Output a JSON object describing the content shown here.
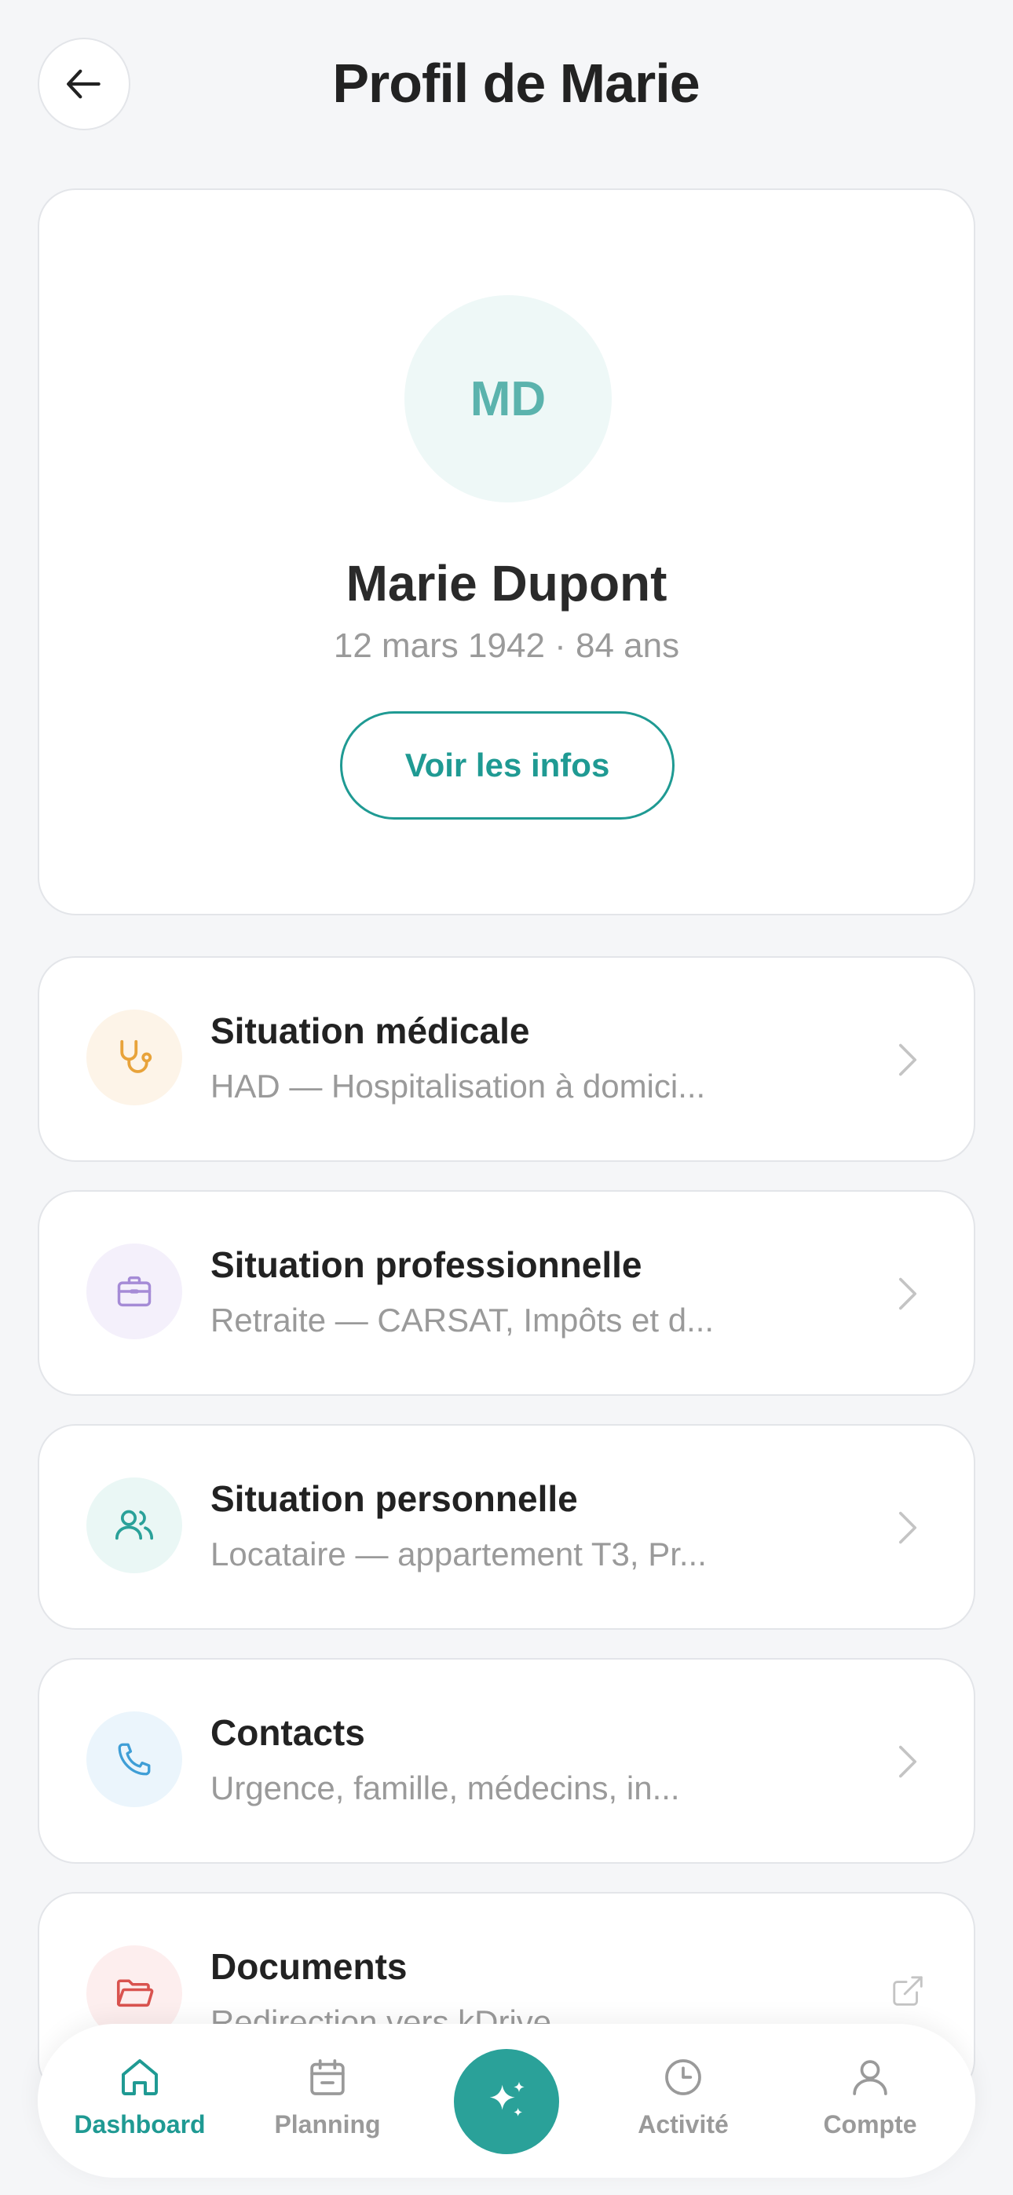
{
  "header": {
    "title": "Profil de Marie"
  },
  "profile": {
    "initials": "MD",
    "name": "Marie Dupont",
    "subtitle": "12 mars 1942 · 84 ans",
    "button_label": "Voir les infos"
  },
  "sections": [
    {
      "title": "Situation médicale",
      "desc": "HAD — Hospitalisation à domici...",
      "icon": "stethoscope-icon",
      "icon_color": "#e8a33a",
      "icon_bg": "#fdf4e8"
    },
    {
      "title": "Situation professionnelle",
      "desc": "Retraite — CARSAT, Impôts et d...",
      "icon": "briefcase-icon",
      "icon_color": "#a58bd6",
      "icon_bg": "#f4f0fb"
    },
    {
      "title": "Situation personnelle",
      "desc": "Locataire — appartement T3, Pr...",
      "icon": "users-icon",
      "icon_color": "#2aa199",
      "icon_bg": "#eaf7f5"
    },
    {
      "title": "Contacts",
      "desc": "Urgence, famille, médecins, in...",
      "icon": "phone-icon",
      "icon_color": "#3f9ed6",
      "icon_bg": "#ebf5fc"
    },
    {
      "title": "Documents",
      "desc": "Redirection vers kDrive",
      "icon": "folder-open-icon",
      "icon_color": "#d9534f",
      "icon_bg": "#fdeeee"
    }
  ],
  "nav": {
    "items": [
      {
        "label": "Dashboard",
        "icon": "home-icon",
        "active": true
      },
      {
        "label": "Planning",
        "icon": "calendar-icon",
        "active": false
      },
      {
        "label": "Activité",
        "icon": "clock-icon",
        "active": false
      },
      {
        "label": "Compte",
        "icon": "user-icon",
        "active": false
      }
    ],
    "fab_icon": "sparkles-icon"
  },
  "colors": {
    "accent": "#1f9a93",
    "fab": "#2aa199",
    "background": "#f5f6f8"
  }
}
